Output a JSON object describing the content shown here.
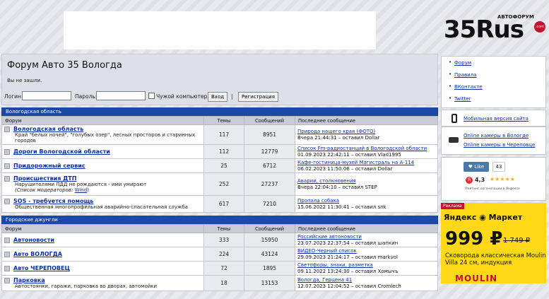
{
  "logo": {
    "name": "35Rus",
    "tagline": "АВТОФОРУМ",
    "domain": ".com"
  },
  "header": {
    "title": "Форум Авто 35 Вологда",
    "not_logged": "Вы не зашли.",
    "login_label": "Логин:",
    "password_label": "Пароль:",
    "remember_label": "Чужой компьютер",
    "login_button": "Вход",
    "separator": "|",
    "register_button": "Регистрация"
  },
  "columns": {
    "forum": "Форум",
    "topics": "Темы",
    "posts": "Сообщений",
    "last": "Последнее сообщение"
  },
  "categories": [
    {
      "title": "Вологодская область",
      "forums": [
        {
          "name": "Вологодская область",
          "desc": "Край \"белых ночей\", \"голубых озер\", лесных просторов и старинных городов",
          "topics": "117",
          "posts": "8951",
          "last_title": "Природа нашего края (ФОТО)",
          "last_date": "Вчера 21:44:31  –  оставил Dollar"
        },
        {
          "name": "Дороги Вологодской области",
          "desc": "",
          "topics": "112",
          "posts": "12779",
          "last_title": "Список Fm-радиостанций в Вологодской области",
          "last_date": "01.09.2023 22:42:11  –  оставил Vlad1995"
        },
        {
          "name": "Придорожный сервис",
          "desc": "",
          "topics": "25",
          "posts": "6712",
          "last_title": "Кафе-гостиница-музей Магистраль на А-114",
          "last_date": "06.02.2023 11:50:06  –  оставил Dollar"
        },
        {
          "name": "Происшествия ДТП",
          "desc": "Нарушителями ПДД не рождаются - ими умирают",
          "mod_label": "(Список модераторов:",
          "mod_name": "Wind",
          "mod_end": ")",
          "topics": "252",
          "posts": "27237",
          "last_title": "Аварии, столкновения",
          "last_date": "Вчера 22:04:10  –  оставил STEP"
        },
        {
          "name": "SOS - требуется помощь",
          "desc": "Общественная многопрофильная аварийно-спасательная служба",
          "topics": "617",
          "posts": "7210",
          "last_title": "Пропала собака",
          "last_date": "15.06.2022 11:30:41  –  оставил snk"
        }
      ]
    },
    {
      "title": "Городские джунгли",
      "forums": [
        {
          "name": "Автоновости",
          "desc": "",
          "topics": "333",
          "posts": "15950",
          "last_title": "Российские автоновости",
          "last_date": "23.07.2023 22:37:54  –  оставил шапкин"
        },
        {
          "name": "Авто ВОЛОГДА",
          "desc": "",
          "topics": "224",
          "posts": "43124",
          "last_title": "ВИДЕО-Черный список",
          "last_date": "29.09.2023 21:24:17  –  оставил markvol"
        },
        {
          "name": "Авто ЧЕРЕПОВЕЦ",
          "desc": "",
          "topics": "72",
          "posts": "1895",
          "last_title": "Светофоры, знаки, разметка",
          "last_date": "09.11.2022 13:24:30  –  оставил Хомычъ"
        },
        {
          "name": "Парковка",
          "desc": "Автостоянки, гаражи, парковка во дворах, автомойки",
          "topics": "18",
          "posts": "13153",
          "last_title": "Вологда, Герцена 41",
          "last_date": "12.07.2023 12:04:52  –  оставил Cromlech"
        }
      ]
    }
  ],
  "sidebar": {
    "links": [
      "Форум",
      "Правила",
      "ВКонтакте",
      "Twitter"
    ],
    "mobile": "Мобильная версия сайта",
    "cam1": "Online камеры в Вологде",
    "cam2": "Online камеры в Череповце",
    "like_label": "Like",
    "like_count": "43",
    "rating": "4,3",
    "rating_stars": "★★★★★",
    "rating_caption": "Рейтинг организации в Яндексе"
  },
  "ad": {
    "label": "Реклама",
    "brand": "Яндекс ◉ Маркет",
    "price": "999 ₽",
    "old_price": "1 749 ₽",
    "text": "Сковорода классическая Moulin Villa 24 см, индукция",
    "logo": "MOULIN"
  }
}
